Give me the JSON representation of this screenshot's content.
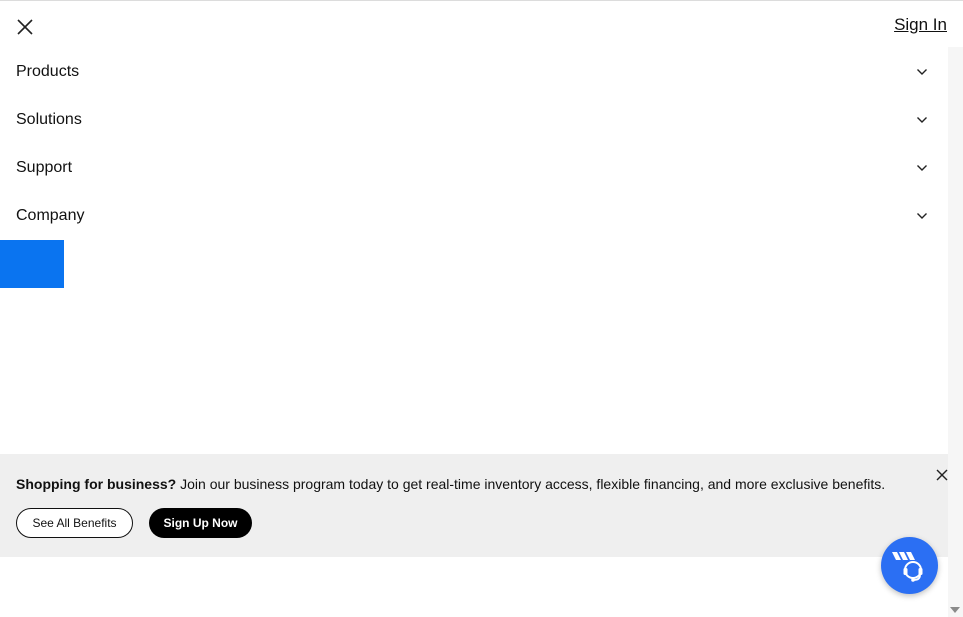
{
  "header": {
    "close_icon": "close-icon",
    "sign_in_label": "Sign In"
  },
  "nav": {
    "items": [
      {
        "label": "Products",
        "icon": "chevron-down-icon"
      },
      {
        "label": "Solutions",
        "icon": "chevron-down-icon"
      },
      {
        "label": "Support",
        "icon": "chevron-down-icon"
      },
      {
        "label": "Company",
        "icon": "chevron-down-icon"
      }
    ]
  },
  "banner": {
    "headline": "Shopping for business?",
    "body": " Join our business program today to get real-time inventory access, flexible financing, and more exclusive benefits.",
    "see_benefits_label": "See All Benefits",
    "sign_up_label": "Sign Up Now",
    "close_icon": "close-icon"
  },
  "chat": {
    "icon": "support-chat-icon"
  },
  "colors": {
    "accent_blue": "#0a74f0",
    "chat_blue": "#2b6ff3",
    "banner_bg": "#efefef"
  }
}
